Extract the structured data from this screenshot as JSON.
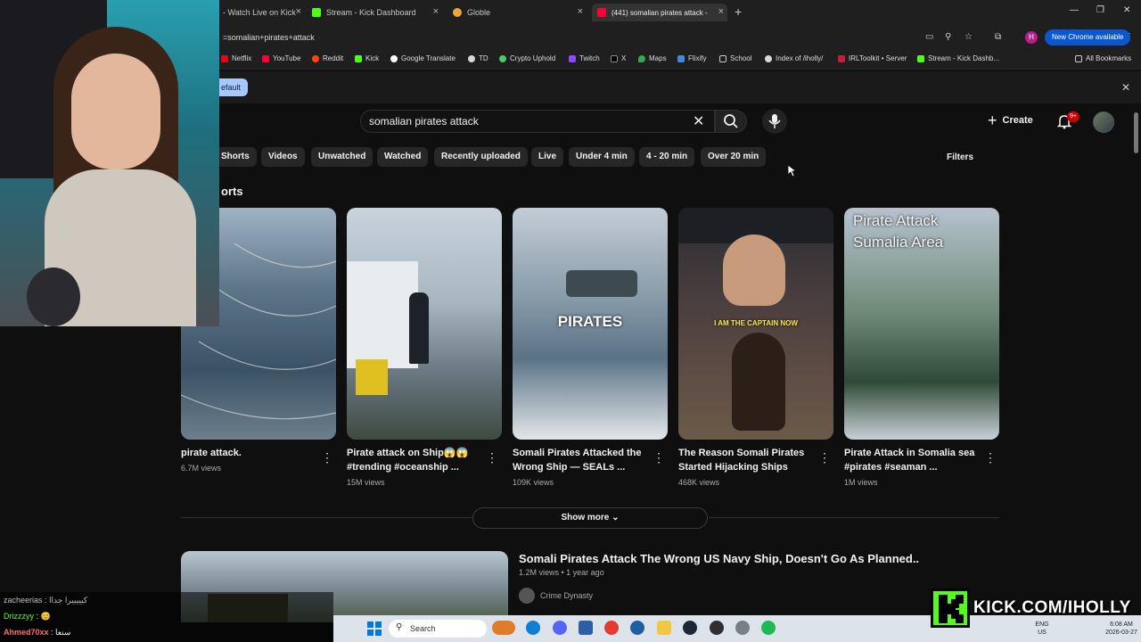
{
  "browser": {
    "tabs": [
      {
        "label": "- Watch Live on Kick",
        "active": false
      },
      {
        "label": "Stream - Kick Dashboard",
        "active": false
      },
      {
        "label": "Globle",
        "active": false
      },
      {
        "label": "(441) somalian pirates attack - ",
        "active": true
      }
    ],
    "url": "=somalian+pirates+attack",
    "new_chrome_label": "New Chrome available",
    "profile_initial": "H",
    "bookmarks": [
      "Netflix",
      "YouTube",
      "Reddit",
      "Kick",
      "Google Translate",
      "TD",
      "Crypto Uphold",
      "Twitch",
      "X",
      "Maps",
      "Flixify",
      "School",
      "Index of /iholly/",
      "IRLToolkit • Server",
      "Stream - Kick Dashb..."
    ],
    "all_bookmarks": "All Bookmarks",
    "info_pill": "efault"
  },
  "youtube": {
    "search_query": "somalian pirates attack",
    "create_label": "Create",
    "notif_count": "9+",
    "chips": [
      "Shorts",
      "Videos",
      "Unwatched",
      "Watched",
      "Recently uploaded",
      "Live",
      "Under 4 min",
      "4 - 20 min",
      "Over 20 min"
    ],
    "filters_label": "Filters",
    "shorts_heading": "orts",
    "shorts": [
      {
        "title": "pirate attack.",
        "views": "6.7M views",
        "overlay": ""
      },
      {
        "title": "Pirate attack on Ship😱😱 #trending #oceanship ...",
        "views": "15M views",
        "overlay": ""
      },
      {
        "title": "Somali Pirates Attacked the Wrong Ship — SEALs ...",
        "views": "109K views",
        "overlay": "PIRATES"
      },
      {
        "title": "The Reason Somali Pirates Started Hijacking Ships",
        "views": "468K views",
        "overlay": "I AM THE CAPTAIN NOW"
      },
      {
        "title": "Pirate Attack in Somalia sea #pirates #seaman ...",
        "views": "1M views",
        "overlay": "Pirate Attack Sumalia Area"
      }
    ],
    "show_more": "Show more",
    "video": {
      "title": "Somali Pirates Attack The Wrong US Navy Ship, Doesn't Go As Planned..",
      "meta": "1.2M views • 1 year ago",
      "channel": "Crime Dynasty"
    }
  },
  "chat": [
    {
      "user": "zacheerias",
      "message": "كيييييرا جداا",
      "color": "#bfbfbf"
    },
    {
      "user": "Drizzzyy",
      "message": "😊",
      "color": "#53fc18"
    },
    {
      "user": "Ahmed70xx",
      "message": "سنعا",
      "color": "#ff6b6b"
    }
  ],
  "taskbar": {
    "search_label": "Search",
    "lang_top": "ENG",
    "lang_bottom": "US",
    "time": "6:08 AM",
    "date": "2026-03-27"
  },
  "overlay": {
    "kick_url": "KICK.COM/IHOLLY"
  }
}
